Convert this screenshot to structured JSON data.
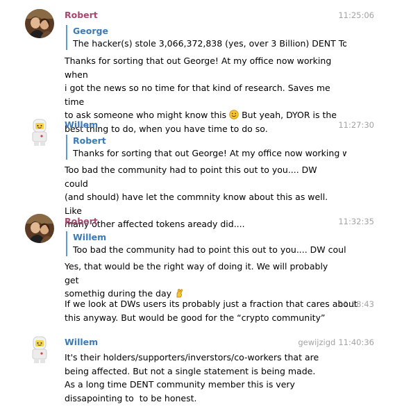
{
  "colors": {
    "robert": "#a5486f",
    "willem": "#3c7ab6",
    "reply_border": "#5d9ad2",
    "time": "#a3a3a3"
  },
  "messages": [
    {
      "sender": "Robert",
      "time": "11:25:06",
      "reply_name": "George",
      "reply_text": "The hacker(s) stole 3,066,372,838 (yes, over 3 Billion) DENT To...",
      "body_lines": [
        "Thanks for sorting that out George! At my office now working when",
        "i got the news so no time for that kind of research. Saves me time",
        "to ask someone who might know this",
        " But yeah, DYOR is the",
        "best thing to do, when you have time to do so."
      ],
      "emoji": "smiley-emoji"
    },
    {
      "sender": "Willem",
      "time": "11:27:30",
      "reply_name": "Robert",
      "reply_text": "Thanks for sorting that out George! At my office now working w...",
      "body_lines": [
        "Too bad the community had to point this out to you.... DW could",
        "(and should) have let the commnity know about this as well. Like",
        "many other affected tokens aready did...."
      ]
    },
    {
      "sender": "Robert",
      "time": "11:32:35",
      "reply_name": "Willem",
      "reply_text": "Too bad the community had to point this out to you.... DW coul...",
      "body_lines": [
        "Yes, that would be the right way of doing it. We will probably get",
        "somethig during the day"
      ],
      "emoji": "crossed-fingers-emoji"
    },
    {
      "time": "11:38:43",
      "body_lines": [
        "If we look at DWs users its probably just a fraction that cares about",
        "this anyway. But would be good for the “crypto community”"
      ]
    },
    {
      "sender": "Willem",
      "edited": "gewijzigd",
      "time": "11:40:36",
      "body_lines": [
        "It's their holders/supporters/inverstors/co-workers that are",
        "being affected. But not a single statement is being made.",
        "As a long time DENT community member this is very",
        "dissapointing to  to be honest."
      ]
    }
  ]
}
